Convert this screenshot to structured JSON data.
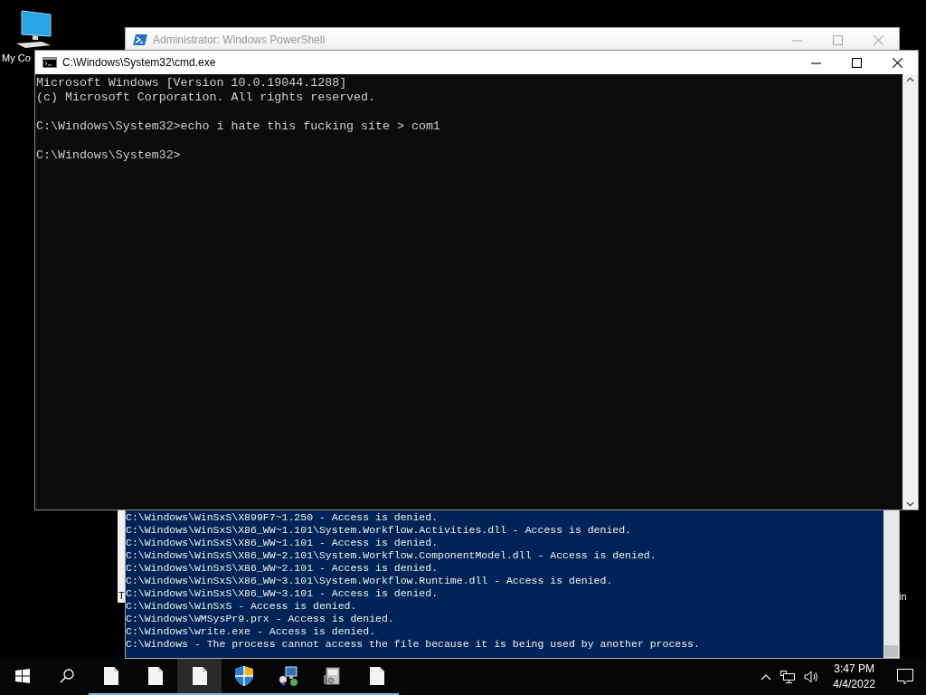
{
  "desktop_icons": [
    {
      "label": "My Co"
    }
  ],
  "background_fragments": [
    {
      "kind": "left",
      "text": "T"
    },
    {
      "kind": "right",
      "text": "in"
    }
  ],
  "windows": [
    {
      "kind": "powershell",
      "title": "Administrator: Windows PowerShell",
      "active": false,
      "lines": [
        "C:\\Windows\\WinSxS\\X899F7~1.250 - Access is denied.",
        "C:\\Windows\\WinSxS\\X86_WW~1.101\\System.Workflow.Activities.dll - Access is denied.",
        "C:\\Windows\\WinSxS\\X86_WW~1.101 - Access is denied.",
        "C:\\Windows\\WinSxS\\X86_WW~2.101\\System.Workflow.ComponentModel.dll - Access is denied.",
        "C:\\Windows\\WinSxS\\X86_WW~2.101 - Access is denied.",
        "C:\\Windows\\WinSxS\\X86_WW~3.101\\System.Workflow.Runtime.dll - Access is denied.",
        "C:\\Windows\\WinSxS\\X86_WW~3.101 - Access is denied.",
        "C:\\Windows\\WinSxS - Access is denied.",
        "C:\\Windows\\WMSysPr9.prx - Access is denied.",
        "C:\\Windows\\write.exe - Access is denied.",
        "C:\\Windows - The process cannot access the file because it is being used by another process."
      ]
    },
    {
      "kind": "cmd",
      "title": "C:\\Windows\\System32\\cmd.exe",
      "active": true,
      "paragraphs": [
        [
          "Microsoft Windows [Version 10.0.19044.1288]",
          "(c) Microsoft Corporation. All rights reserved."
        ],
        [
          "C:\\Windows\\System32>echo i hate this fucking site > com1"
        ],
        [
          "C:\\Windows\\System32>"
        ]
      ]
    }
  ],
  "taskbar": {
    "buttons": [
      {
        "kind": "start",
        "running": false,
        "selected": false
      },
      {
        "kind": "search",
        "running": false,
        "selected": false
      },
      {
        "kind": "document",
        "running": true,
        "selected": false
      },
      {
        "kind": "document",
        "running": true,
        "selected": false
      },
      {
        "kind": "document",
        "running": true,
        "selected": true
      },
      {
        "kind": "shield",
        "running": true,
        "selected": false
      },
      {
        "kind": "network",
        "running": true,
        "selected": false
      },
      {
        "kind": "archive",
        "running": true,
        "selected": false
      },
      {
        "kind": "document",
        "running": true,
        "selected": false
      }
    ],
    "tray": {
      "time": "3:47 PM",
      "date": "4/4/2022"
    }
  }
}
